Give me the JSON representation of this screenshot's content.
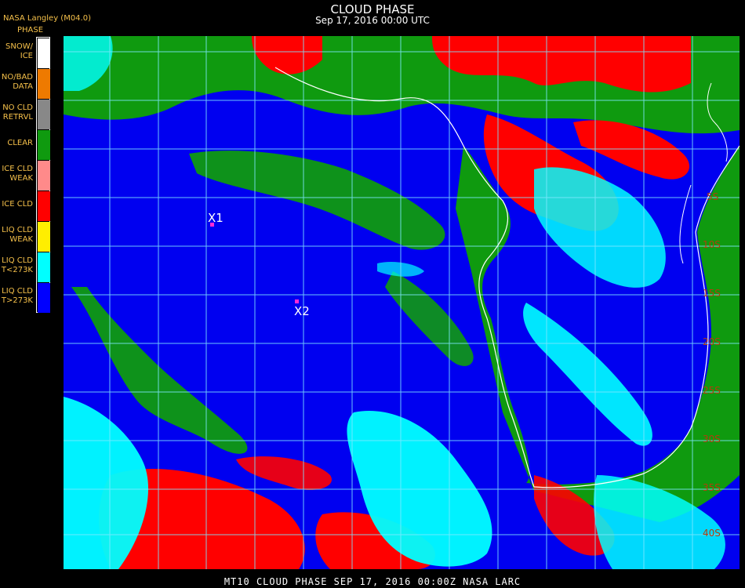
{
  "header": {
    "title": "CLOUD PHASE",
    "subtitle": "Sep 17, 2016 00:00 UTC",
    "credit": "NASA Langley (M04.0)"
  },
  "legend": {
    "title": "PHASE",
    "items": [
      {
        "label": "SNOW/\nICE",
        "color": "#ffffff"
      },
      {
        "label": "NO/BAD\nDATA",
        "color": "#ee7a00"
      },
      {
        "label": "NO CLD\nRETRVL",
        "color": "#888888"
      },
      {
        "label": "CLEAR",
        "color": "#0f9a0f"
      },
      {
        "label": "ICE CLD\nWEAK",
        "color": "#ff8a8a"
      },
      {
        "label": "ICE CLD",
        "color": "#ff0000"
      },
      {
        "label": "LIQ CLD\nWEAK",
        "color": "#ffee00"
      },
      {
        "label": "LIQ CLD\nT<273K",
        "color": "#00ffff"
      },
      {
        "label": "LIQ CLD\nT>273K",
        "color": "#0000ff"
      }
    ]
  },
  "map": {
    "latitude_labels": [
      "5S",
      "10S",
      "15S",
      "20S",
      "25S",
      "30S",
      "35S",
      "40S"
    ],
    "markers": [
      {
        "label": "X1",
        "color": "#ff2bd6"
      },
      {
        "label": "X2",
        "color": "#ff2bd6"
      }
    ],
    "gridline_color": "#7fe8ff",
    "coastline_color": "#ffffff"
  },
  "footer": {
    "text": "MT10   CLOUD PHASE   SEP 17, 2016 00:00Z   NASA LARC"
  }
}
